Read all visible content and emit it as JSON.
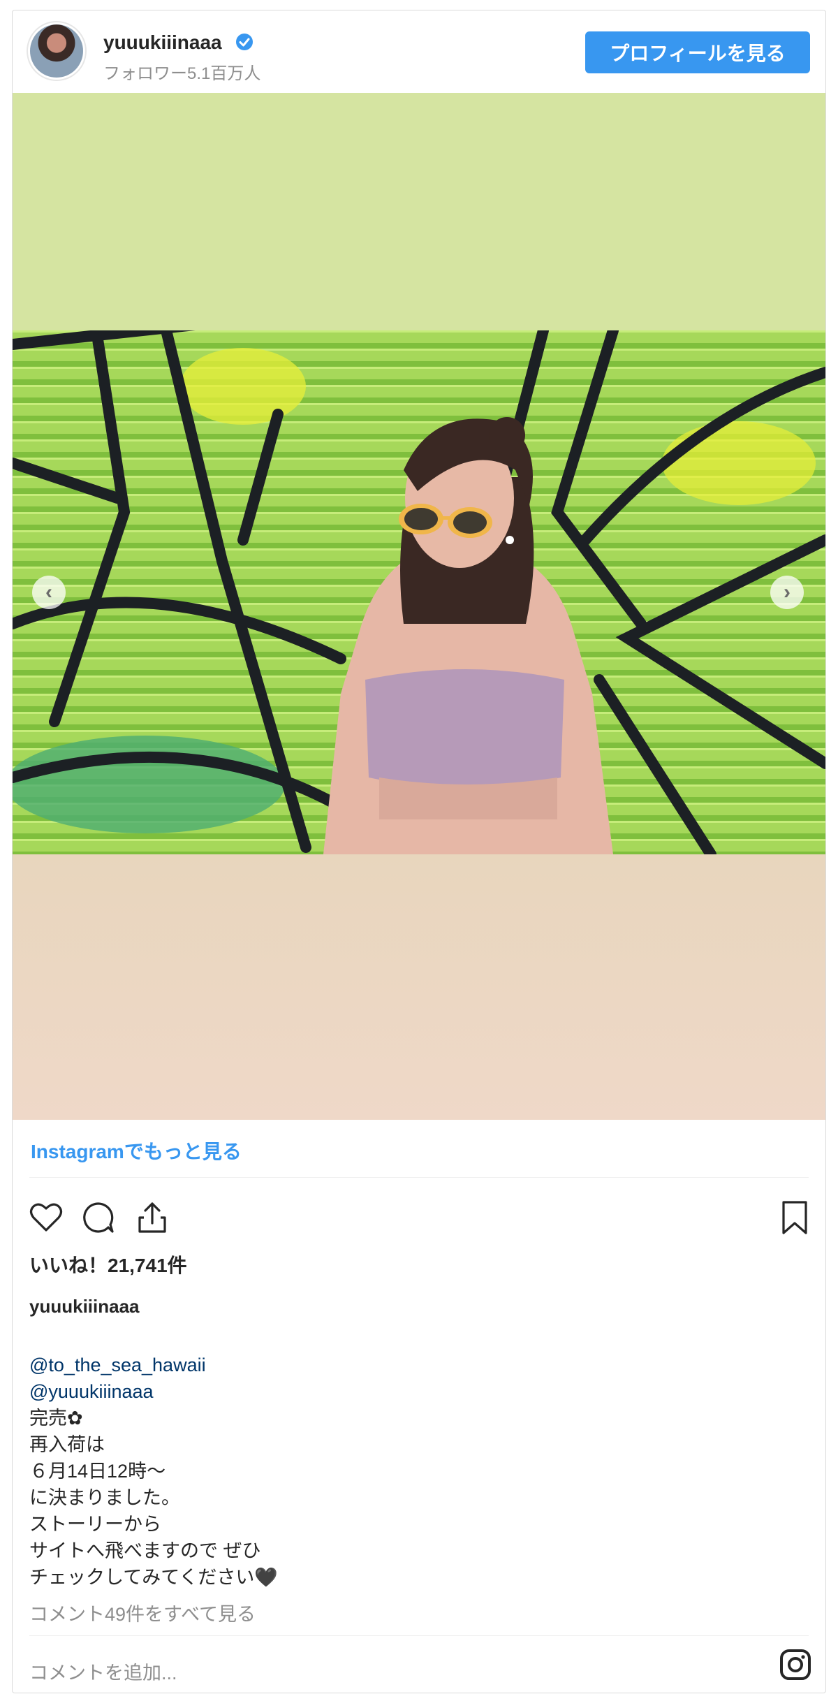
{
  "header": {
    "username": "yuuukiiinaaa",
    "followers": "フォロワー5.1百万人",
    "profile_button": "プロフィールを見る"
  },
  "media": {
    "prev_arrow": "‹",
    "next_arrow": "›"
  },
  "more_link": "Instagramでもっと見る",
  "actions": {
    "like_icon": "heart-icon",
    "comment_icon": "comment-icon",
    "share_icon": "share-icon",
    "save_icon": "bookmark-icon"
  },
  "likes": "いいね！21,741件",
  "caption": {
    "username": "yuuukiiinaaa",
    "mentions": [
      "@to_the_sea_hawaii",
      "@yuuukiiinaaa"
    ],
    "lines": [
      "完売✿",
      "再入荷は",
      "６月14日12時〜",
      "に決まりました。",
      "ストーリーから",
      "サイトへ飛べますので ぜひ",
      "チェックしてみてください🖤"
    ]
  },
  "view_comments": "コメント49件をすべて見る",
  "add_comment_placeholder": "コメントを追加...",
  "colors": {
    "accent": "#3897f0",
    "mention": "#003569",
    "muted": "#8e8e8e"
  }
}
